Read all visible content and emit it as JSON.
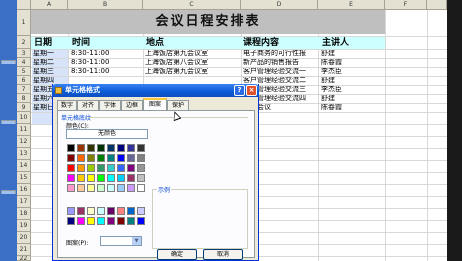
{
  "sheet": {
    "columns": [
      "A",
      "B",
      "C",
      "D",
      "E",
      "F"
    ],
    "rows": [
      "1",
      "2",
      "3",
      "4",
      "5",
      "6",
      "7",
      "8",
      "9",
      "10",
      "11",
      "12",
      "13",
      "14",
      "15",
      "16",
      "17",
      "18",
      "19",
      "20",
      "21",
      "22"
    ],
    "title": "会议日程安排表",
    "headers": [
      "日期",
      "时间",
      "地点",
      "课程内容",
      "主讲人"
    ],
    "data_rows": [
      {
        "date": "星期一",
        "time": "8:30-11:00",
        "place": "上海饭店第九会议室",
        "topic": "电子商务的可行性报",
        "speaker": "舒建"
      },
      {
        "date": "星期二",
        "time": "8:30-11:00",
        "place": "上海饭店第八会议室",
        "topic": "新产品的销售报告",
        "speaker": "陈春霞"
      },
      {
        "date": "星期三",
        "time": "8:30-11:00",
        "place": "上海饭店第九会议室",
        "topic": "客户管理经验交流一",
        "speaker": "李杰臣"
      },
      {
        "date": "星期四",
        "time": "",
        "place": "",
        "topic": "客户管理经验交流二",
        "speaker": "舒建"
      },
      {
        "date": "星期五",
        "time": "",
        "place": "",
        "topic": "客户管理经验交流三",
        "speaker": "李杰臣"
      },
      {
        "date": "星期六",
        "time": "",
        "place": "",
        "topic": "客户管理经验交流四",
        "speaker": "舒建"
      },
      {
        "date": "星期日",
        "time": "",
        "place": "",
        "topic": "总结会议",
        "speaker": "陈春霞"
      }
    ]
  },
  "dialog": {
    "title": "单元格格式",
    "help_glyph": "?",
    "close_glyph": "×",
    "tabs": [
      "数字",
      "对齐",
      "字体",
      "边框",
      "图案",
      "保护"
    ],
    "active_tab": "图案",
    "group_label": "单元格底纹",
    "color_label": "颜色(C):",
    "no_color": "无颜色",
    "sample_label": "示例",
    "pattern_label": "图案(P):",
    "pattern_arrow": "▼",
    "ok": "确定",
    "cancel": "取消",
    "swatch_colors_top": [
      "#000000",
      "#993300",
      "#333300",
      "#003300",
      "#003366",
      "#000080",
      "#333399",
      "#333333",
      "#800000",
      "#ff6600",
      "#808000",
      "#008000",
      "#008080",
      "#0000ff",
      "#666699",
      "#808080",
      "#ff0000",
      "#ff9900",
      "#99cc00",
      "#339966",
      "#33cccc",
      "#3366ff",
      "#800080",
      "#969696",
      "#ff00ff",
      "#ffcc00",
      "#ffff00",
      "#00ff00",
      "#00ffff",
      "#00ccff",
      "#993366",
      "#c0c0c0",
      "#ff99cc",
      "#ffcc99",
      "#ffff99",
      "#ccffcc",
      "#ccffff",
      "#99ccff",
      "#cc99ff",
      "#ffffff"
    ],
    "swatch_colors_bottom": [
      "#9999ff",
      "#993366",
      "#ffffcc",
      "#ccffff",
      "#660066",
      "#ff8080",
      "#0066cc",
      "#ccccff",
      "#000080",
      "#ff00ff",
      "#ffff00",
      "#00ffff",
      "#800080",
      "#800000",
      "#008080",
      "#0000ff"
    ]
  },
  "colors": {
    "title_band": "#bfbfbf",
    "header_band": "#ccffff",
    "dialog_title": "#0a5bd6",
    "dialog_face": "#ece9d8"
  }
}
